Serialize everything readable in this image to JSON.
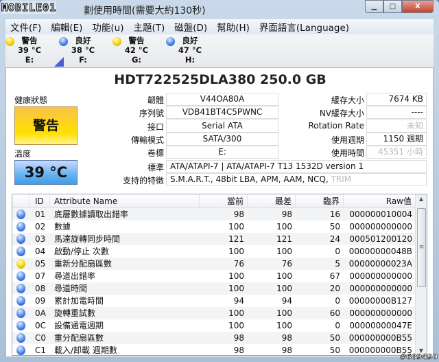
{
  "window": {
    "logo": "MOBILE01",
    "title": "劃使用時間(需要大約130秒)",
    "min": "▁",
    "max": "□",
    "close": "X"
  },
  "menu": [
    "文件(F)",
    "編輯(E)",
    "功能(u)",
    "主題(T)",
    "磁盤(D)",
    "幫助(H)",
    "界面語言(Language)"
  ],
  "drives": [
    {
      "status": "警告",
      "temp": "39 °C",
      "letter": "E:",
      "color": "#f3d400"
    },
    {
      "status": "良好",
      "temp": "38 °C",
      "letter": "F:",
      "color": "#4b86ea"
    },
    {
      "status": "警告",
      "temp": "42 °C",
      "letter": "G:",
      "color": "#f3d400"
    },
    {
      "status": "良好",
      "temp": "47 °C",
      "letter": "H:",
      "color": "#4b86ea"
    }
  ],
  "disk": {
    "model": "HDT722525DLA380  250.0 GB",
    "health_label": "健康狀態",
    "health": "警告",
    "temp_label": "溫度",
    "temp": "39 °C",
    "left": [
      {
        "label": "韌體",
        "value": "V44OA80A"
      },
      {
        "label": "序列號",
        "value": "VDB41BT4C5PWNC"
      },
      {
        "label": "接口",
        "value": "Serial ATA"
      },
      {
        "label": "傳輸模式",
        "value": "SATA/300"
      },
      {
        "label": "卷標",
        "value": "E:"
      }
    ],
    "right": [
      {
        "label": "緩存大小",
        "value": "7674 KB"
      },
      {
        "label": "NV緩存大小",
        "value": "----"
      },
      {
        "label": "Rotation Rate",
        "value": "未知"
      },
      {
        "label": "使用週期",
        "value": "1150 週期"
      },
      {
        "label": "使用時間",
        "value": "45351 小時"
      }
    ],
    "standard_label": "標準",
    "standard": "ATA/ATAPI-7 | ATA/ATAPI-7 T13 1532D version 1",
    "features_label": "支持的特徵",
    "features": "S.M.A.R.T., 48bit LBA, APM, AAM, NCQ,",
    "features_off": "TRIM"
  },
  "table": {
    "headers": [
      "ID",
      "Attribute Name",
      "當前",
      "最差",
      "臨界",
      "Raw值"
    ],
    "rows": [
      {
        "status": "good",
        "id": "01",
        "name": "底層數據讀取出錯率",
        "cur": "98",
        "worst": "98",
        "thr": "16",
        "raw": "000000010004"
      },
      {
        "status": "good",
        "id": "02",
        "name": "數據",
        "cur": "100",
        "worst": "100",
        "thr": "50",
        "raw": "000000000000"
      },
      {
        "status": "good",
        "id": "03",
        "name": "馬達旋轉同步時間",
        "cur": "121",
        "worst": "121",
        "thr": "24",
        "raw": "000501200120"
      },
      {
        "status": "good",
        "id": "04",
        "name": "啟動/停止 次數",
        "cur": "100",
        "worst": "100",
        "thr": "0",
        "raw": "00000000048B"
      },
      {
        "status": "warn",
        "id": "05",
        "name": "重新分配扇區數",
        "cur": "76",
        "worst": "76",
        "thr": "5",
        "raw": "00000000023A"
      },
      {
        "status": "good",
        "id": "07",
        "name": "尋道出錯率",
        "cur": "100",
        "worst": "100",
        "thr": "67",
        "raw": "000000000000"
      },
      {
        "status": "good",
        "id": "08",
        "name": "尋道時間",
        "cur": "100",
        "worst": "100",
        "thr": "20",
        "raw": "000000000000"
      },
      {
        "status": "good",
        "id": "09",
        "name": "累計加電時間",
        "cur": "94",
        "worst": "94",
        "thr": "0",
        "raw": "00000000B127"
      },
      {
        "status": "good",
        "id": "0A",
        "name": "旋轉重試數",
        "cur": "100",
        "worst": "100",
        "thr": "60",
        "raw": "000000000000"
      },
      {
        "status": "good",
        "id": "0C",
        "name": "設備通電週期",
        "cur": "100",
        "worst": "100",
        "thr": "0",
        "raw": "00000000047E"
      },
      {
        "status": "good",
        "id": "C0",
        "name": "重分配扇區數",
        "cur": "98",
        "worst": "98",
        "thr": "50",
        "raw": "000000000B55"
      },
      {
        "status": "good",
        "id": "C1",
        "name": "載入/卸載 週期數",
        "cur": "98",
        "worst": "98",
        "thr": "50",
        "raw": "000000000B55"
      }
    ]
  },
  "watermark": "#689490"
}
